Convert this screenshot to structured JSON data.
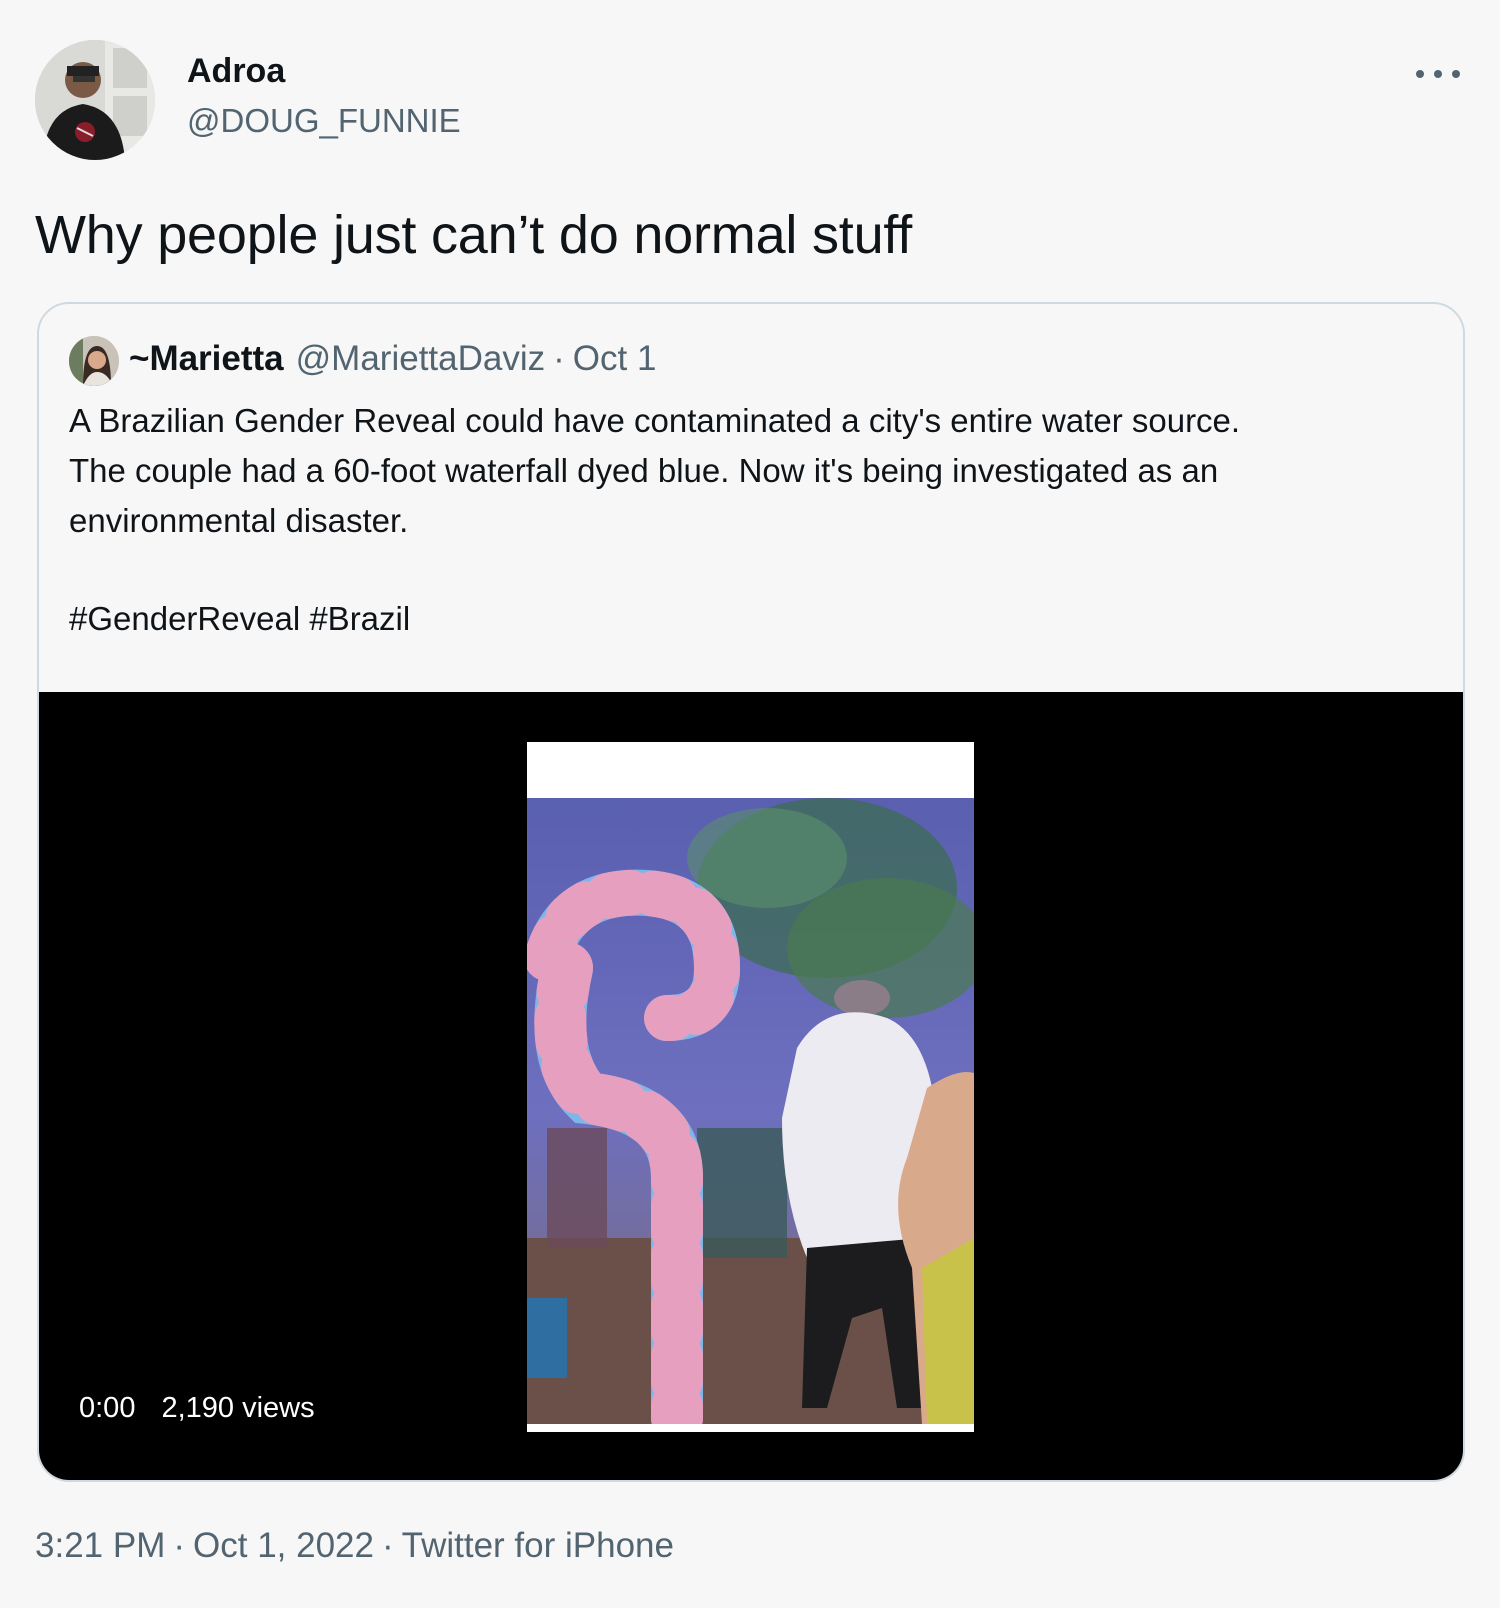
{
  "author": {
    "display_name": "Adroa",
    "handle": "@DOUG_FUNNIE"
  },
  "tweet_text": "Why people just can’t do normal stuff",
  "quoted_tweet": {
    "display_name": "~Marietta",
    "handle": "@MariettaDaviz",
    "separator": "·",
    "date": "Oct 1",
    "text_lines": [
      "A Brazilian Gender Reveal could have contaminated a city's entire water source.",
      "The couple had a 60-foot waterfall dyed blue. Now it's being investigated as an",
      "environmental disaster."
    ],
    "hashtags": [
      "#GenderReveal",
      "#Brazil"
    ],
    "media": {
      "type": "video",
      "duration": "0:00",
      "views": "2,190 views"
    }
  },
  "footer": {
    "time": "3:21 PM",
    "separator": "·",
    "date": "Oct 1, 2022",
    "source": "Twitter for iPhone"
  },
  "icons": {
    "more": "more-horizontal-icon"
  },
  "colors": {
    "background": "#f7f7f7",
    "text_primary": "#0f1419",
    "text_secondary": "#536471",
    "card_border": "#cfd9de",
    "media_background": "#000000"
  }
}
